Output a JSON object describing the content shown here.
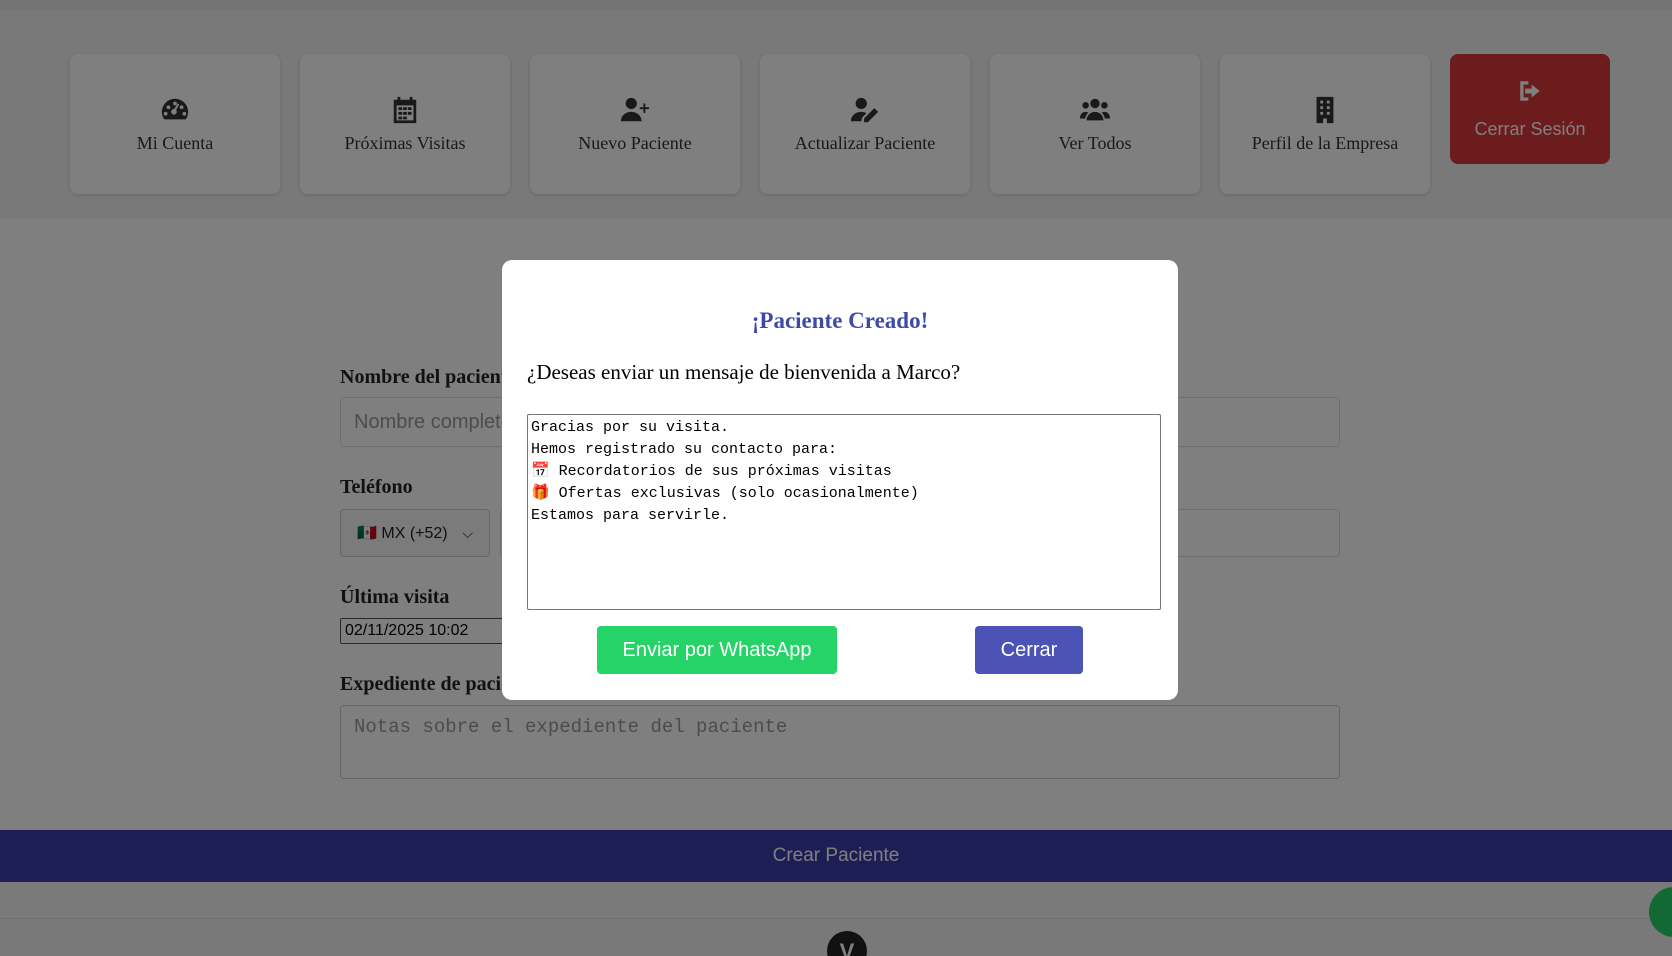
{
  "nav": {
    "items": [
      {
        "label": "Mi Cuenta",
        "icon": "dashboard-gauge-icon"
      },
      {
        "label": "Próximas Visitas",
        "icon": "calendar-icon"
      },
      {
        "label": "Nuevo Paciente",
        "icon": "user-plus-icon"
      },
      {
        "label": "Actualizar Paciente",
        "icon": "user-edit-icon"
      },
      {
        "label": "Ver Todos",
        "icon": "users-group-icon"
      },
      {
        "label": "Perfil de la Empresa",
        "icon": "building-icon"
      }
    ],
    "logout": {
      "label": "Cerrar Sesión",
      "icon": "sign-out-icon"
    }
  },
  "form": {
    "name_label": "Nombre del paciente",
    "name_placeholder": "Nombre completo",
    "phone_label": "Teléfono",
    "phone_country": "🇲🇽 MX (+52)",
    "last_visit_label": "Última visita",
    "last_visit_value": "02/11/2025 10:02",
    "record_label": "Expediente de paciente",
    "record_placeholder": "Notas sobre el expediente del paciente",
    "submit_label": "Crear Paciente"
  },
  "footer": {
    "logo_letter": "V"
  },
  "modal": {
    "title": "¡Paciente Creado!",
    "question": "¿Deseas enviar un mensaje de bienvenida a Marco?",
    "message": "Gracias por su visita.\nHemos registrado su contacto para:\n📅 Recordatorios de sus próximas visitas\n🎁 Ofertas exclusivas (solo ocasionalmente)\nEstamos para servirle.",
    "whatsapp_label": "Enviar por WhatsApp",
    "close_label": "Cerrar"
  },
  "colors": {
    "primary": "#3a3fa8",
    "whatsapp": "#25d366",
    "danger": "#d8383b",
    "title": "#3f4aa6"
  }
}
